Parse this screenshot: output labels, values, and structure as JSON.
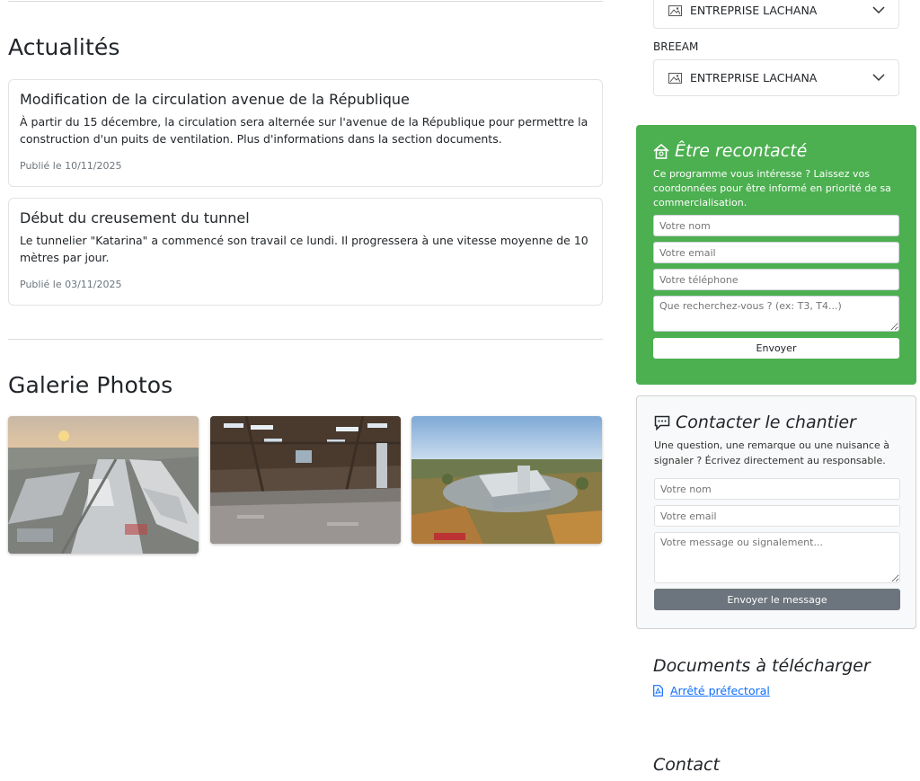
{
  "news": {
    "title": "Actualités",
    "items": [
      {
        "title": "Modification de la circulation avenue de la République",
        "body": "À partir du 15 décembre, la circulation sera alternée sur l'avenue de la République pour permettre la construction d'un puits de ventilation. Plus d'informations dans la section documents.",
        "date": "Publié le 10/11/2025"
      },
      {
        "title": "Début du creusement du tunnel",
        "body": "Le tunnelier \"Katarina\" a commencé son travail ce lundi. Il progressera à une vitesse moyenne de 10 mètres par jour.",
        "date": "Publié le 03/11/2025"
      }
    ]
  },
  "gallery": {
    "title": "Galerie Photos",
    "photos": [
      "aerial-industrial-park-photo",
      "steel-warehouse-frame-photo",
      "logistics-center-aerial-photo"
    ]
  },
  "selects": {
    "first_value": "ENTREPRISE LACHANA",
    "breeam_label": "BREEAM",
    "breeam_value": "ENTREPRISE LACHANA"
  },
  "recontact": {
    "title": "Être recontacté",
    "description": "Ce programme vous intéresse ? Laissez vos coordonnées pour être informé en priorité de sa commercialisation.",
    "name_placeholder": "Votre nom",
    "email_placeholder": "Votre email",
    "phone_placeholder": "Votre téléphone",
    "search_placeholder": "Que recherchez-vous ? (ex: T3, T4...)",
    "submit_label": "Envoyer",
    "bg_color": "#4caf50"
  },
  "chantier": {
    "title": "Contacter le chantier",
    "description": "Une question, une remarque ou une nuisance à signaler ? Écrivez directement au responsable.",
    "name_placeholder": "Votre nom",
    "email_placeholder": "Votre email",
    "message_placeholder": "Votre message ou signalement...",
    "submit_label": "Envoyer le message"
  },
  "documents": {
    "title": "Documents à télécharger",
    "link_label": "Arrêté préfectoral"
  },
  "contact": {
    "title": "Contact"
  }
}
